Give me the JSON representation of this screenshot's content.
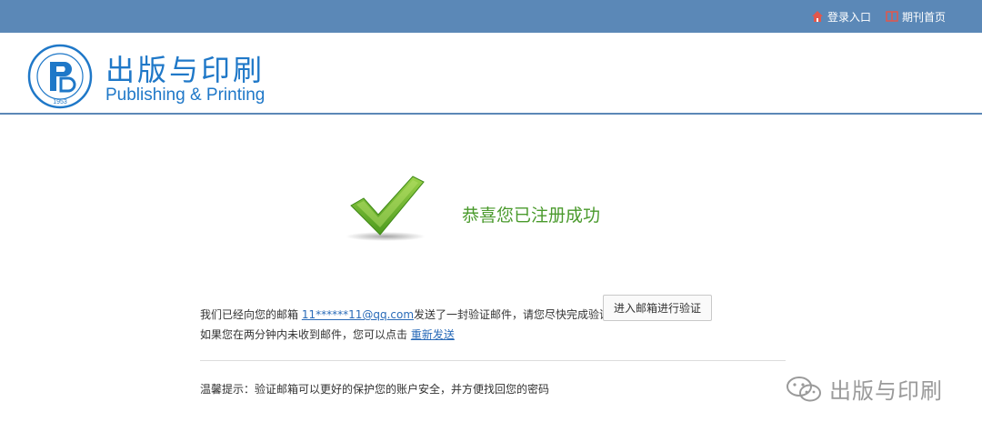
{
  "topnav": {
    "login_label": "登录入口",
    "journal_home_label": "期刊首页"
  },
  "brand": {
    "name_cn": "出版与印刷",
    "name_en": "Publishing & Printing",
    "seal_year": "1953",
    "seal_text": "上海出版印刷高等专科学校"
  },
  "success": {
    "message": "恭喜您已注册成功"
  },
  "email_notice": {
    "line1_prefix": "我们已经向您的邮箱 ",
    "email": "11******11@qq.com",
    "line1_suffix": "发送了一封验证邮件，请您尽快完成验证",
    "line2_prefix": "如果您在两分钟内未收到邮件，您可以点击 ",
    "resend_link": "重新发送",
    "verify_button": "进入邮箱进行验证"
  },
  "tip": {
    "text": "温馨提示：验证邮箱可以更好的保护您的账户安全，并方便找回您的密码"
  },
  "watermark": {
    "text": "出版与印刷"
  },
  "colors": {
    "topbar": "#5b88b7",
    "brand_blue": "#1f78c8",
    "success_green": "#4a9a2c",
    "link_blue": "#2a6bb8"
  }
}
